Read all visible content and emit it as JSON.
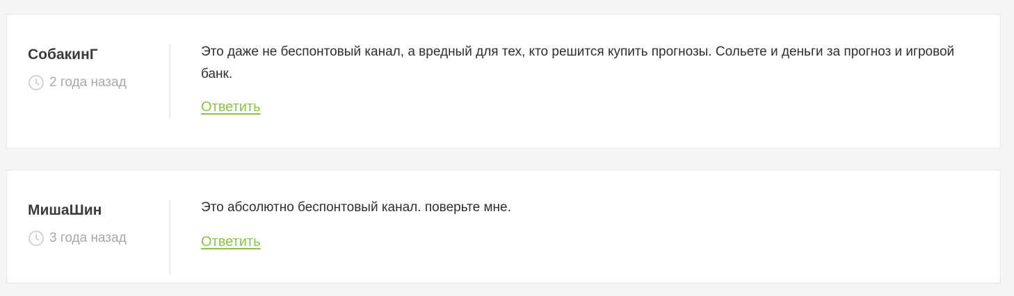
{
  "comments": [
    {
      "author": "СобакинГ",
      "time": "2 года назад",
      "text": "Это даже не беспонтовый канал, а вредный для тех, кто решится купить прогнозы. Сольете и деньги за прогноз и игровой банк.",
      "reply_label": "Ответить"
    },
    {
      "author": "МишаШин",
      "time": "3 года назад",
      "text": "Это абсолютно беспонтовый канал. поверьте мне.",
      "reply_label": "Ответить"
    }
  ],
  "icons": {
    "time": "clock-icon"
  },
  "colors": {
    "page_background": "#f5f5f5",
    "card_background": "#ffffff",
    "author": "#3b3b3b",
    "muted": "#a8a8a8",
    "text": "#2e2e2e",
    "reply_link": "#8bc34a"
  }
}
